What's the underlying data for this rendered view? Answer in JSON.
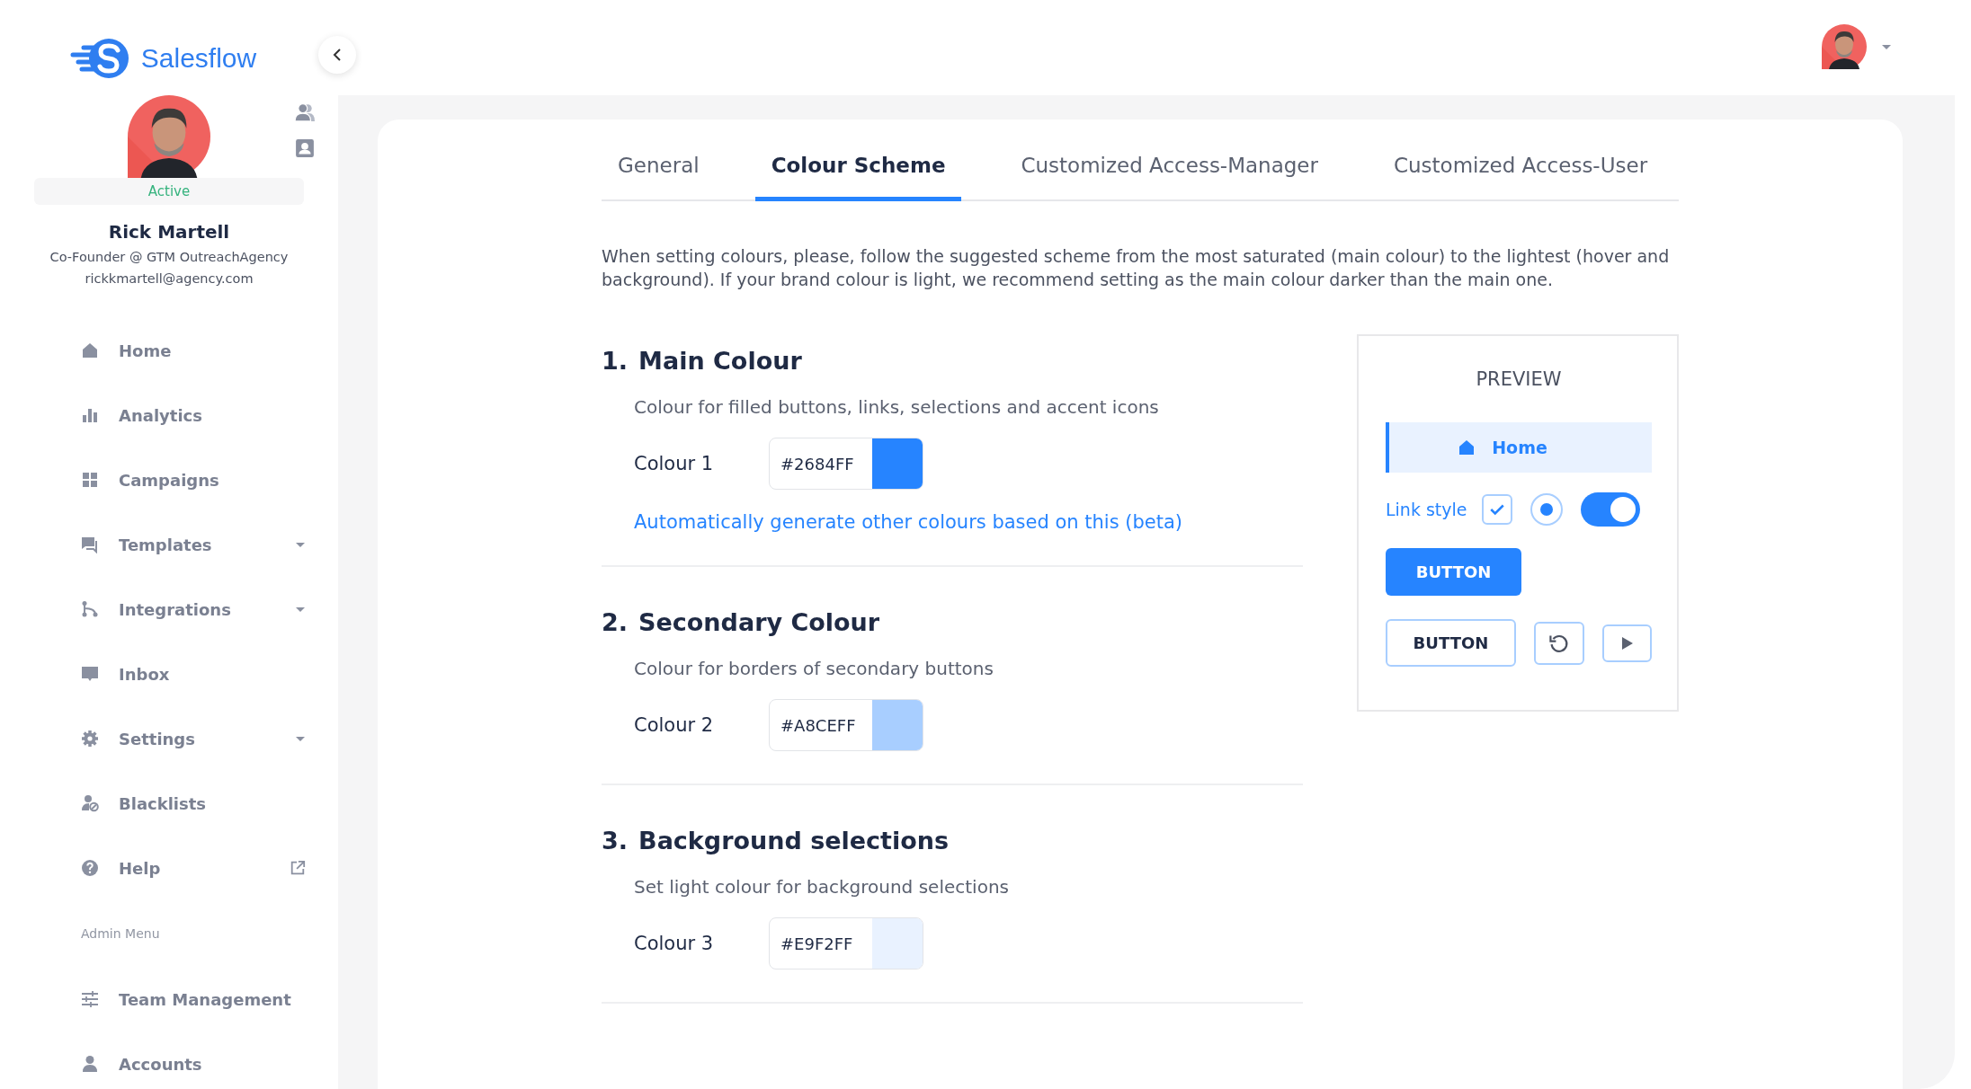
{
  "brand": {
    "name": "Salesflow"
  },
  "profile": {
    "status": "Active",
    "name": "Rick Martell",
    "role": "Co-Founder @ GTM OutreachAgency",
    "email": "rickkmartell@agency.com"
  },
  "sidebar": {
    "items": [
      {
        "label": "Home",
        "kind": "plain"
      },
      {
        "label": "Analytics",
        "kind": "plain"
      },
      {
        "label": "Campaigns",
        "kind": "plain"
      },
      {
        "label": "Templates",
        "kind": "submenu"
      },
      {
        "label": "Integrations",
        "kind": "submenu"
      },
      {
        "label": "Inbox",
        "kind": "plain"
      },
      {
        "label": "Settings",
        "kind": "submenu"
      },
      {
        "label": "Blacklists",
        "kind": "plain"
      },
      {
        "label": "Help",
        "kind": "external"
      }
    ],
    "admin_heading": "Admin Menu",
    "admin_items": [
      {
        "label": "Team Management"
      },
      {
        "label": "Accounts"
      }
    ]
  },
  "tabs": [
    {
      "label": "General",
      "selected": false
    },
    {
      "label": "Colour Scheme",
      "selected": true
    },
    {
      "label": "Customized Access-Manager",
      "selected": false
    },
    {
      "label": "Customized Access-User",
      "selected": false
    }
  ],
  "intro": "When setting colours, please, follow the suggested scheme from the most saturated (main colour) to the lightest (hover and background). If your brand colour is light, we recommend setting as the main colour darker than the main one.",
  "sections": [
    {
      "number": "1.",
      "title": "Main Colour",
      "description": "Colour for filled buttons, links, selections and accent icons",
      "field_label": "Colour 1",
      "value": "#2684FF",
      "color": "#2684ff",
      "link": "Automatically generate other colours based on this (beta)"
    },
    {
      "number": "2.",
      "title": "Secondary Colour",
      "description": "Colour for borders of secondary buttons",
      "field_label": "Colour 2",
      "value": "#A8CEFF",
      "color": "#a8ceff"
    },
    {
      "number": "3.",
      "title": "Background selections",
      "description": "Set light colour for background selections",
      "field_label": "Colour 3",
      "value": "#E9F2FF",
      "color": "#e9f2ff"
    }
  ],
  "preview": {
    "title": "PREVIEW",
    "nav_item": "Home",
    "link_label": "Link style",
    "checkbox_checked": true,
    "radio_selected": true,
    "toggle_on": true,
    "primary_button": "BUTTON",
    "secondary_button": "BUTTON"
  }
}
